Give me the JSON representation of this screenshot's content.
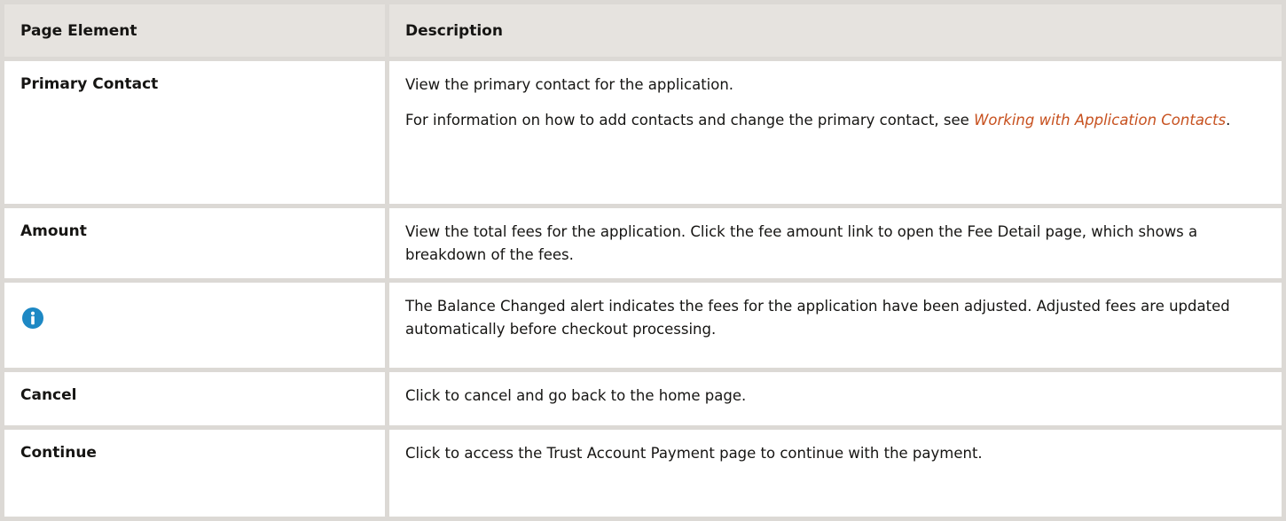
{
  "table": {
    "headers": {
      "element": "Page Element",
      "description": "Description"
    },
    "rows": [
      {
        "element": "Primary Contact",
        "description_1": "View the primary contact for the application.",
        "description_2_prefix": "For information on how to add contacts and change the primary contact, see ",
        "link_text": "Working with Application Contacts",
        "description_2_suffix": "."
      },
      {
        "element": "Amount",
        "description": "View the total fees for the application. Click the fee amount link to open the Fee Detail page, which shows a breakdown of the fees."
      },
      {
        "element_icon": "info-icon",
        "icon_color": "#1d88c4",
        "description": "The Balance Changed alert indicates the fees for the application have been adjusted. Adjusted fees are updated automatically before checkout processing."
      },
      {
        "element": "Cancel",
        "description": "Click to cancel and go back to the home page."
      },
      {
        "element": "Continue",
        "description": "Click to access the Trust Account Payment page to continue with the payment."
      }
    ]
  }
}
